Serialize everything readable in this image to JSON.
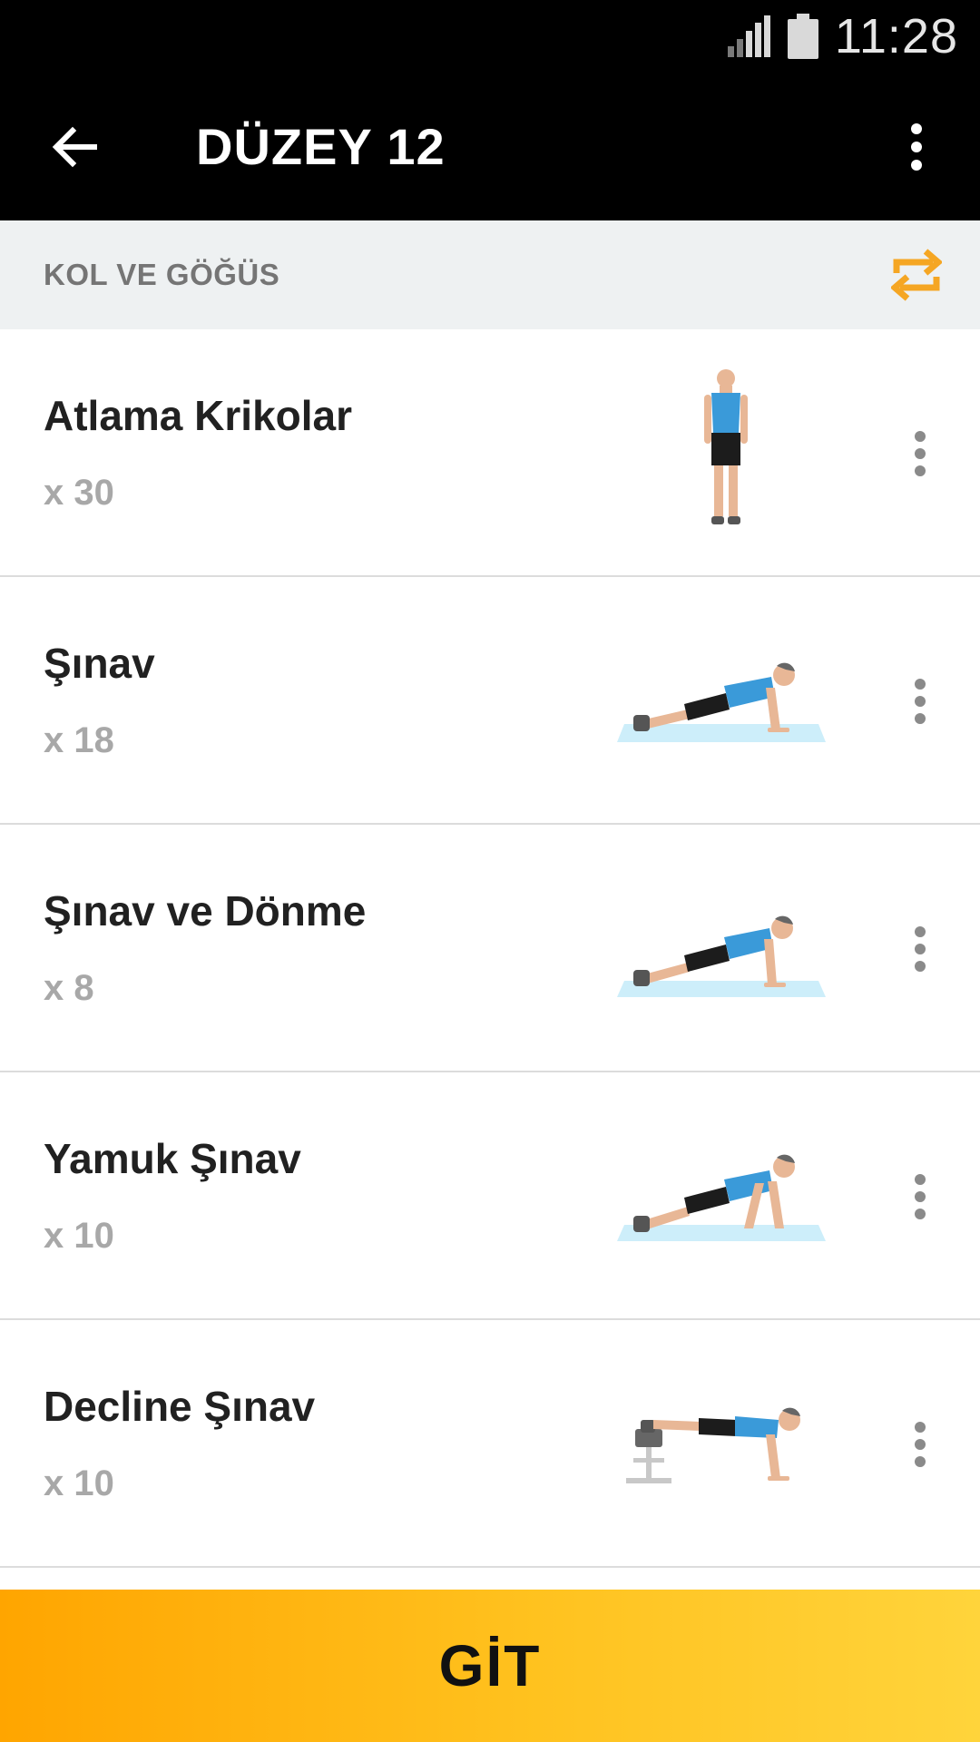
{
  "status_bar": {
    "time": "11:28",
    "icons": [
      "signal-icon",
      "battery-icon"
    ]
  },
  "app_bar": {
    "title": "DÜZEY 12",
    "icons": [
      "back-arrow-icon",
      "more-vertical-icon"
    ]
  },
  "section": {
    "title": "KOL VE GÖĞÜS",
    "icon": "repeat-icon",
    "accent_color": "#f5a623"
  },
  "exercises": [
    {
      "name": "Atlama Krikolar",
      "count": "x 30",
      "illustration": "standing-figure"
    },
    {
      "name": "Şınav",
      "count": "x 18",
      "illustration": "push-up-figure"
    },
    {
      "name": "Şınav ve Dönme",
      "count": "x 8",
      "illustration": "push-up-figure"
    },
    {
      "name": "Yamuk Şınav",
      "count": "x 10",
      "illustration": "push-up-figure"
    },
    {
      "name": "Decline Şınav",
      "count": "x 10",
      "illustration": "decline-push-up-figure"
    }
  ],
  "go_button": {
    "label": "GİT",
    "color": "#ffb300"
  }
}
